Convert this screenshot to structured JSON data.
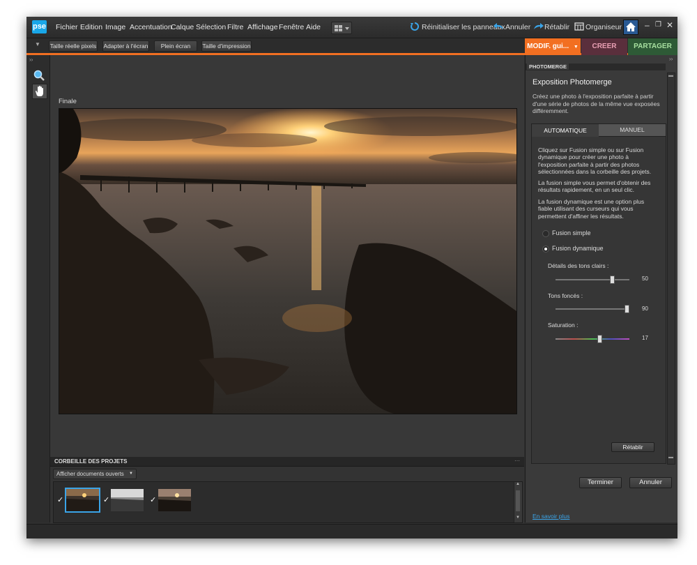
{
  "app": {
    "logo": "pse"
  },
  "menu": [
    "Fichier",
    "Edition",
    "Image",
    "Accentuation",
    "Calque",
    "Sélection",
    "Filtre",
    "Affichage",
    "Fenêtre",
    "Aide"
  ],
  "commands": {
    "reset_panels": "Réinitialiser les panneaux",
    "undo": "Annuler",
    "redo": "Rétablir",
    "organizer": "Organiseur"
  },
  "toolbar": {
    "buttons": [
      "Taille réelle pixels",
      "Adapter à l'écran",
      "Plein écran",
      "Taille d'impression"
    ]
  },
  "mode_tabs": {
    "edit": "MODIF. gui...",
    "create": "CREER",
    "share": "PARTAGER"
  },
  "colors": {
    "accent": "#f26f21",
    "create_tab": "#5a2f3c",
    "share_tab": "#2e5a36",
    "logo": "#19a7e8"
  },
  "canvas": {
    "image_label": "Finale"
  },
  "bin": {
    "title": "CORBEILLE DES PROJETS",
    "dropdown": "Afficher documents ouverts",
    "thumb_count": 3
  },
  "panel": {
    "tab": "PHOTOMERGE",
    "title": "Exposition Photomerge",
    "description": "Créez une photo à l'exposition parfaite à partir d'une série de photos de la même vue exposées différemment.",
    "tabs": [
      "AUTOMATIQUE",
      "MANUEL"
    ],
    "text1": "Cliquez sur Fusion simple ou sur Fusion dynamique pour créer une photo à l'exposition parfaite à partir des photos sélectionnées dans la corbeille des projets.",
    "text2": "La fusion simple vous permet d'obtenir des résultats rapidement, en un seul clic.",
    "text3": "La fusion dynamique est une option plus fiable utilisant des curseurs qui vous permettent d'affiner les résultats.",
    "radio_simple": "Fusion simple",
    "radio_dynamic": "Fusion dynamique",
    "sliders": [
      {
        "label": "Détails des tons clairs :",
        "value": "50",
        "fraction": 0.75
      },
      {
        "label": "Tons foncés :",
        "value": "90",
        "fraction": 0.95
      },
      {
        "label": "Saturation :",
        "value": "17",
        "fraction": 0.58
      }
    ],
    "reset_button": "Rétablir",
    "finish_button": "Terminer",
    "cancel_button": "Annuler",
    "learn_more": "En savoir plus"
  }
}
